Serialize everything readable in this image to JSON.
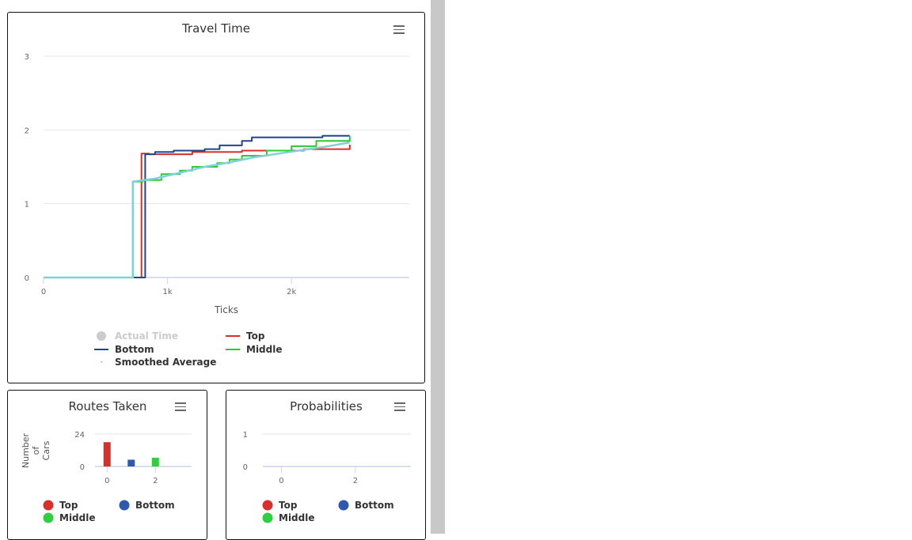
{
  "charts": {
    "travel_time": {
      "title": "Travel Time",
      "menu_icon": "hamburger-menu-icon"
    },
    "routes_taken": {
      "title": "Routes Taken",
      "menu_icon": "hamburger-menu-icon"
    },
    "probabilities": {
      "title": "Probabilities",
      "menu_icon": "hamburger-menu-icon"
    }
  },
  "chart_data": [
    {
      "type": "line",
      "title": "Travel Time",
      "xlabel": "Ticks",
      "ylabel": "",
      "xlim": [
        0,
        2950
      ],
      "ylim": [
        0,
        3
      ],
      "x_ticks": [
        0,
        1000,
        2000
      ],
      "x_tick_labels": [
        "0",
        "1k",
        "2k"
      ],
      "y_ticks": [
        0,
        1,
        2,
        3
      ],
      "y_tick_labels": [
        "0",
        "1",
        "2",
        "3"
      ],
      "grid": true,
      "legend_position": "bottom",
      "series": [
        {
          "name": "Actual Time",
          "color": "#cccccc",
          "hidden": true,
          "style": "marker",
          "points": []
        },
        {
          "name": "Top",
          "color": "#d7302a",
          "style": "step",
          "points": [
            [
              0,
              0
            ],
            [
              790,
              0
            ],
            [
              790,
              1.68
            ],
            [
              850,
              1.68
            ],
            [
              850,
              1.67
            ],
            [
              1200,
              1.67
            ],
            [
              1200,
              1.7
            ],
            [
              1600,
              1.7
            ],
            [
              1600,
              1.72
            ],
            [
              2100,
              1.72
            ],
            [
              2100,
              1.74
            ],
            [
              2470,
              1.74
            ],
            [
              2470,
              1.8
            ]
          ]
        },
        {
          "name": "Bottom",
          "color": "#23438f",
          "style": "step",
          "points": [
            [
              0,
              0
            ],
            [
              820,
              0
            ],
            [
              820,
              1.67
            ],
            [
              900,
              1.67
            ],
            [
              900,
              1.7
            ],
            [
              1050,
              1.7
            ],
            [
              1050,
              1.72
            ],
            [
              1300,
              1.72
            ],
            [
              1300,
              1.74
            ],
            [
              1420,
              1.74
            ],
            [
              1420,
              1.79
            ],
            [
              1600,
              1.79
            ],
            [
              1600,
              1.85
            ],
            [
              1680,
              1.85
            ],
            [
              1680,
              1.9
            ],
            [
              2250,
              1.9
            ],
            [
              2250,
              1.92
            ],
            [
              2470,
              1.92
            ]
          ]
        },
        {
          "name": "Middle",
          "color": "#2fc835",
          "style": "step",
          "points": [
            [
              0,
              0
            ],
            [
              720,
              0
            ],
            [
              720,
              1.3
            ],
            [
              800,
              1.3
            ],
            [
              800,
              1.32
            ],
            [
              950,
              1.32
            ],
            [
              950,
              1.4
            ],
            [
              1100,
              1.4
            ],
            [
              1100,
              1.45
            ],
            [
              1200,
              1.45
            ],
            [
              1200,
              1.5
            ],
            [
              1400,
              1.5
            ],
            [
              1400,
              1.55
            ],
            [
              1500,
              1.55
            ],
            [
              1500,
              1.6
            ],
            [
              1600,
              1.6
            ],
            [
              1600,
              1.65
            ],
            [
              1800,
              1.65
            ],
            [
              1800,
              1.72
            ],
            [
              2000,
              1.72
            ],
            [
              2000,
              1.78
            ],
            [
              2200,
              1.78
            ],
            [
              2200,
              1.85
            ],
            [
              2470,
              1.85
            ],
            [
              2470,
              1.92
            ]
          ]
        },
        {
          "name": "Smoothed Average",
          "color": "#7fd0d8",
          "style": "line",
          "points": [
            [
              0,
              0
            ],
            [
              720,
              0
            ],
            [
              720,
              1.3
            ],
            [
              900,
              1.34
            ],
            [
              1100,
              1.42
            ],
            [
              1300,
              1.5
            ],
            [
              1500,
              1.56
            ],
            [
              1700,
              1.63
            ],
            [
              1900,
              1.68
            ],
            [
              2100,
              1.73
            ],
            [
              2300,
              1.78
            ],
            [
              2470,
              1.83
            ]
          ]
        }
      ]
    },
    {
      "type": "bar",
      "title": "Routes Taken",
      "xlabel": "",
      "ylabel": "Number of Cars",
      "xlim": [
        -0.5,
        3.5
      ],
      "ylim": [
        0,
        24
      ],
      "x_ticks": [
        0,
        2
      ],
      "x_tick_labels": [
        "0",
        "2"
      ],
      "y_ticks": [
        0,
        24
      ],
      "y_tick_labels": [
        "0",
        "24"
      ],
      "grid": true,
      "legend_position": "bottom",
      "series": [
        {
          "name": "Top",
          "color": "#d7302a",
          "x": 0,
          "value": 18
        },
        {
          "name": "Bottom",
          "color": "#2f58b0",
          "x": 1,
          "value": 5
        },
        {
          "name": "Middle",
          "color": "#2fd03f",
          "x": 2,
          "value": 6.5
        }
      ]
    },
    {
      "type": "line",
      "title": "Probabilities",
      "xlabel": "",
      "ylabel": "",
      "xlim": [
        -0.5,
        3.5
      ],
      "ylim": [
        0,
        1
      ],
      "x_ticks": [
        0,
        2
      ],
      "x_tick_labels": [
        "0",
        "2"
      ],
      "y_ticks": [
        0,
        1
      ],
      "y_tick_labels": [
        "0",
        "1"
      ],
      "grid": true,
      "legend_position": "bottom",
      "series": [
        {
          "name": "Top",
          "color": "#d7302a",
          "points": []
        },
        {
          "name": "Bottom",
          "color": "#2f58b0",
          "points": []
        },
        {
          "name": "Middle",
          "color": "#2fd03f",
          "points": []
        }
      ]
    }
  ]
}
